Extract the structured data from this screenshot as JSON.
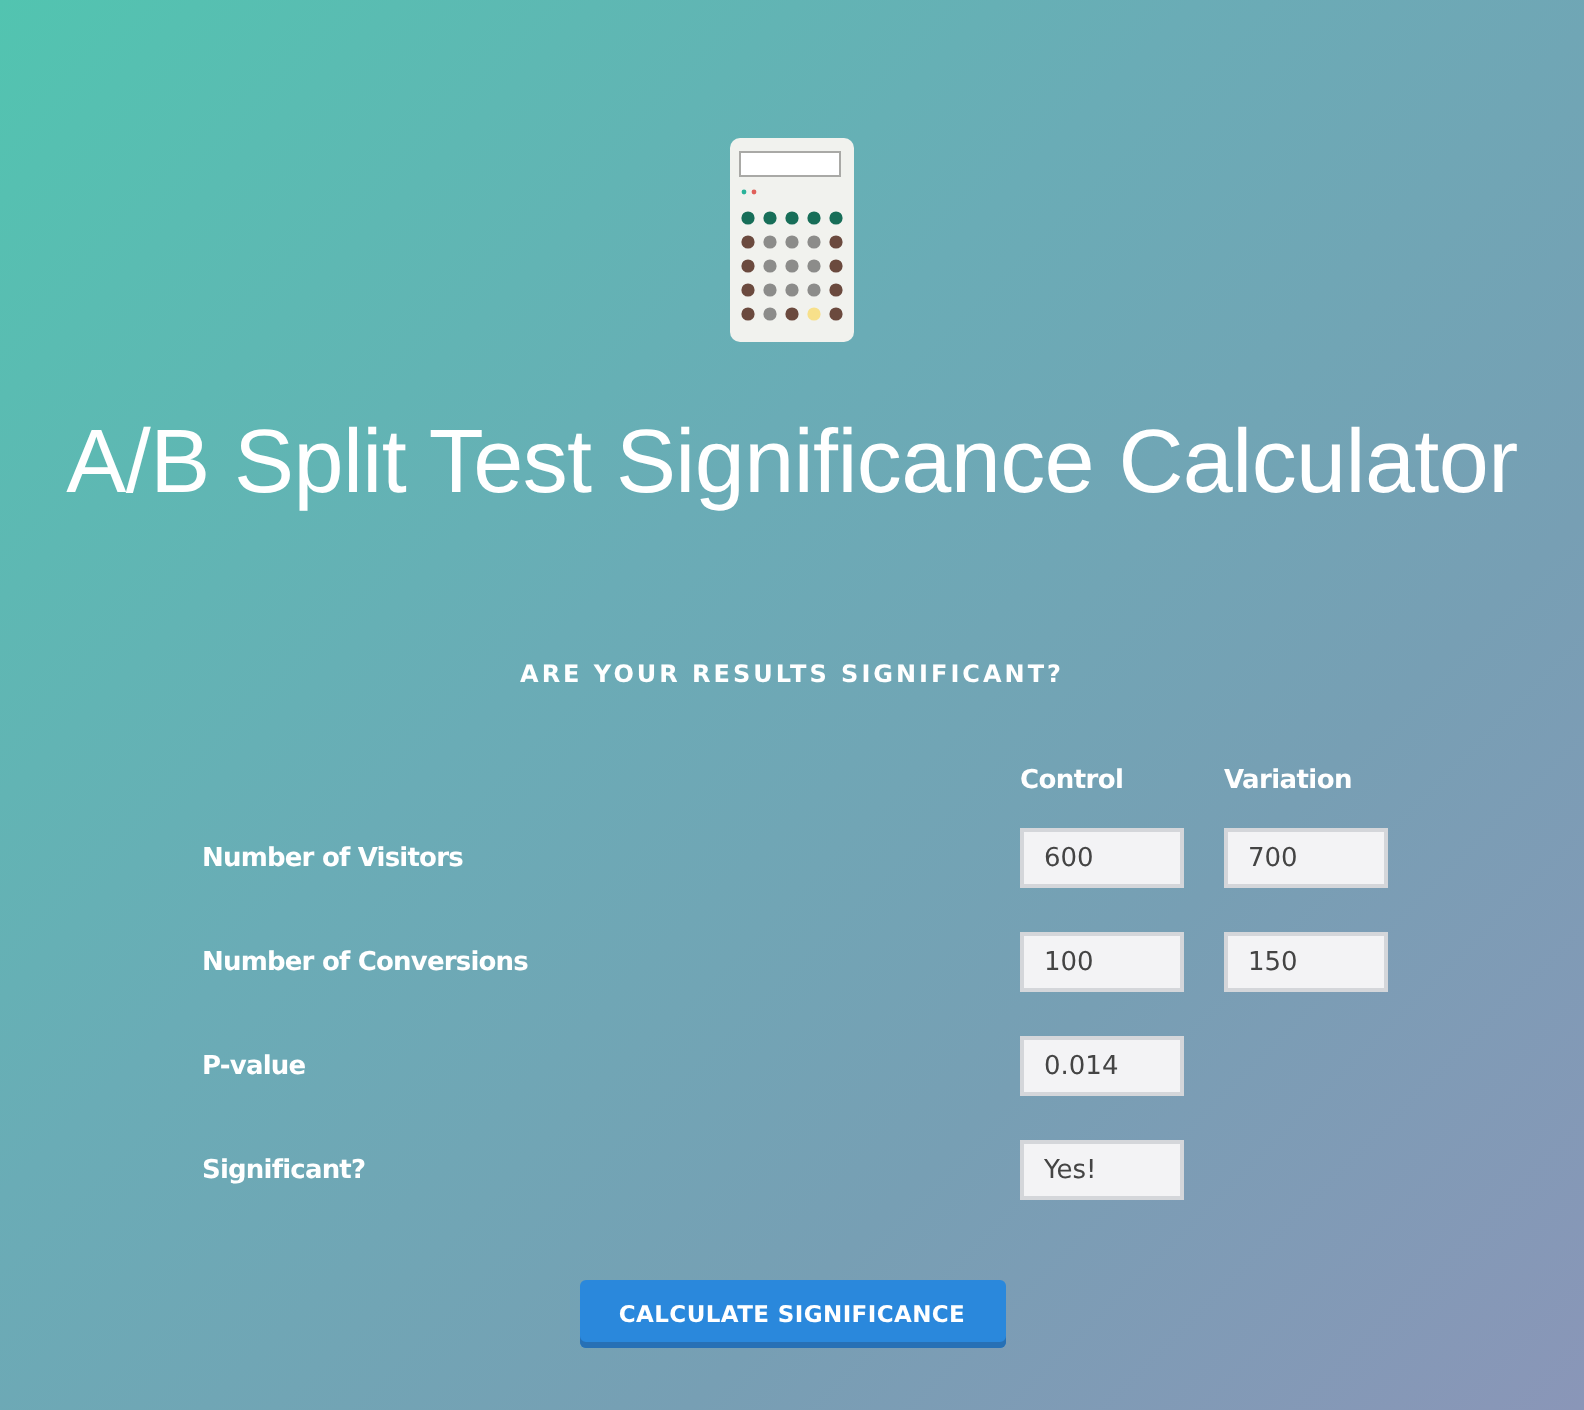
{
  "title": "A/B Split Test Significance Calculator",
  "subtitle": "ARE YOUR RESULTS SIGNIFICANT?",
  "columns": [
    "Control",
    "Variation"
  ],
  "rows": [
    {
      "label": "Number of Visitors",
      "values": [
        "600",
        "700"
      ]
    },
    {
      "label": "Number of Conversions",
      "values": [
        "100",
        "150"
      ]
    },
    {
      "label": "P-value",
      "values": [
        "0.014"
      ]
    },
    {
      "label": "Significant?",
      "values": [
        "Yes!"
      ]
    }
  ],
  "button": "CALCULATE SIGNIFICANCE"
}
